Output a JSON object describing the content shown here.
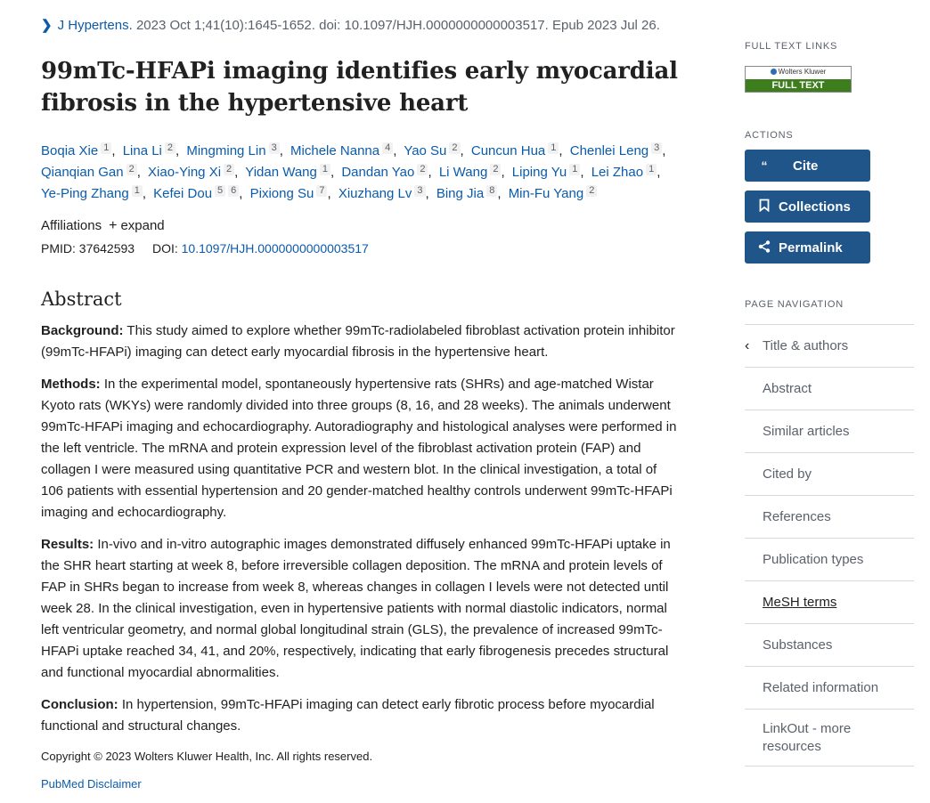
{
  "citation": {
    "journal": "J Hypertens.",
    "details": "2023 Oct 1;41(10):1645-1652. doi: 10.1097/HJH.0000000000003517. Epub 2023 Jul 26."
  },
  "title_line1": "99mTc-HFAPi imaging identifies early myocardial",
  "title_line2": "fibrosis in the hypertensive heart",
  "authors": [
    {
      "name": "Boqia Xie",
      "aff": "1"
    },
    {
      "name": "Lina Li",
      "aff": "2"
    },
    {
      "name": "Mingming Lin",
      "aff": "3"
    },
    {
      "name": "Michele Nanna",
      "aff": "4"
    },
    {
      "name": "Yao Su",
      "aff": "2"
    },
    {
      "name": "Cuncun Hua",
      "aff": "1"
    },
    {
      "name": "Chenlei Leng",
      "aff": "3"
    },
    {
      "name": "Qianqian Gan",
      "aff": "2"
    },
    {
      "name": "Xiao-Ying Xi",
      "aff": "2"
    },
    {
      "name": "Yidan Wang",
      "aff": "1"
    },
    {
      "name": "Dandan Yao",
      "aff": "2"
    },
    {
      "name": "Li Wang",
      "aff": "2"
    },
    {
      "name": "Liping Yu",
      "aff": "1"
    },
    {
      "name": "Lei Zhao",
      "aff": "1"
    },
    {
      "name": "Ye-Ping Zhang",
      "aff": "1"
    },
    {
      "name": "Kefei Dou",
      "aff": "5",
      "aff2": "6"
    },
    {
      "name": "Pixiong Su",
      "aff": "7"
    },
    {
      "name": "Xiuzhang Lv",
      "aff": "3"
    },
    {
      "name": "Bing Jia",
      "aff": "8"
    },
    {
      "name": "Min-Fu Yang",
      "aff": "2"
    }
  ],
  "affiliations_label": "Affiliations",
  "expand_label": "expand",
  "pmid_label": "PMID:",
  "pmid": "37642593",
  "doi_label": "DOI:",
  "doi": "10.1097/HJH.0000000000003517",
  "abstract_heading": "Abstract",
  "abstract": [
    {
      "label": "Background:",
      "text": "This study aimed to explore whether 99mTc-radiolabeled fibroblast activation protein inhibitor (99mTc-HFAPi) imaging can detect early myocardial fibrosis in the hypertensive heart."
    },
    {
      "label": "Methods:",
      "text": "In the experimental model, spontaneously hypertensive rats (SHRs) and age-matched Wistar Kyoto rats (WKYs) were randomly divided into three groups (8, 16, and 28 weeks). The animals underwent 99mTc-HFAPi imaging and echocardiography. Autoradiography and histological analyses were performed in the left ventricle. The mRNA and protein expression level of the fibroblast activation protein (FAP) and collagen I were measured using quantitative PCR and western blot. In the clinical investigation, a total of 106 patients with essential hypertension and 20 gender-matched healthy controls underwent 99mTc-HFAPi imaging and echocardiography."
    },
    {
      "label": "Results:",
      "text": "In-vivo and in-vitro autographic images demonstrated diffusely enhanced 99mTc-HFAPi uptake in the SHR heart starting at week 8, before irreversible collagen deposition. The mRNA and protein levels of FAP in SHRs began to increase from week 8, whereas changes in collagen I levels were not detected until week 28. In the clinical investigation, even in hypertensive patients with normal diastolic indicators, normal left ventricular geometry, and normal global longitudinal strain (GLS), the prevalence of increased 99mTc-HFAPi uptake reached 34, 41, and 20%, respectively, indicating that early fibrogenesis precedes structural and functional myocardial abnormalities."
    },
    {
      "label": "Conclusion:",
      "text": "In hypertension, 99mTc-HFAPi imaging can detect early fibrotic process before myocardial functional and structural changes."
    }
  ],
  "copyright": "Copyright © 2023 Wolters Kluwer Health, Inc. All rights reserved.",
  "disclaimer": "PubMed Disclaimer",
  "sidebar": {
    "full_text_links_heading": "FULL TEXT LINKS",
    "logo_brand": "Wolters Kluwer",
    "logo_text": "FULL TEXT",
    "actions_heading": "ACTIONS",
    "cite": "Cite",
    "collections": "Collections",
    "permalink": "Permalink",
    "page_nav_heading": "PAGE NAVIGATION",
    "nav": [
      "Title & authors",
      "Abstract",
      "Similar articles",
      "Cited by",
      "References",
      "Publication types",
      "MeSH terms",
      "Substances",
      "Related information",
      "LinkOut - more resources"
    ]
  },
  "colors": {
    "link": "#0b5bab",
    "button": "#20558a",
    "logo_green": "#3e7d1e"
  }
}
